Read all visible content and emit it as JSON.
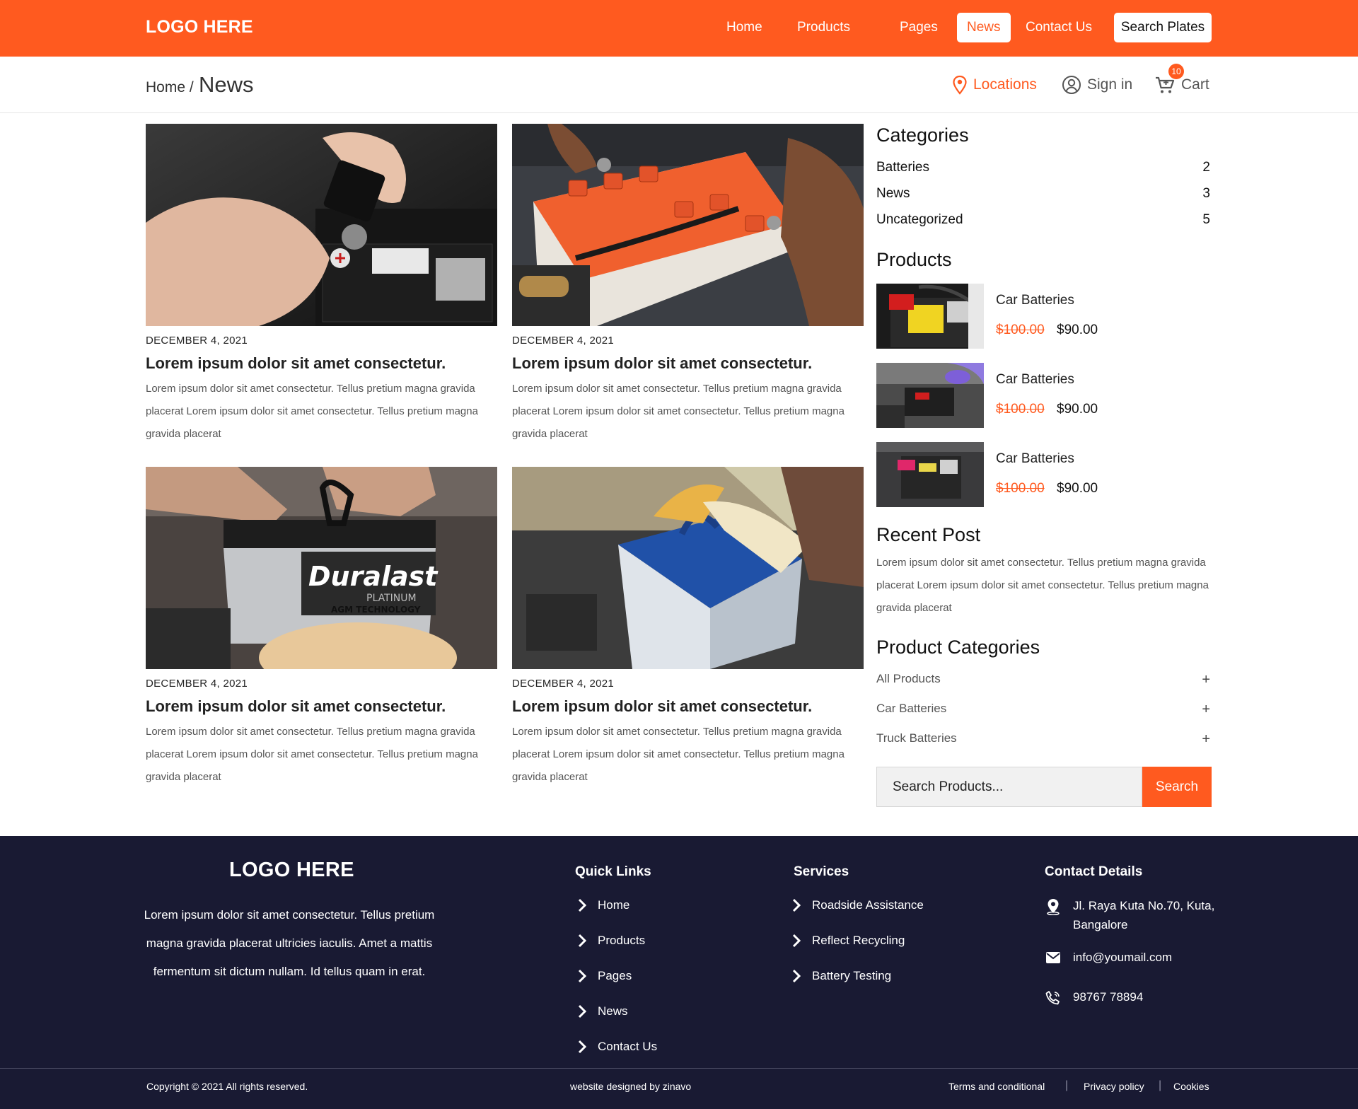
{
  "header": {
    "logo": "LOGO HERE",
    "nav": [
      "Home",
      "Products",
      "Pages",
      "News",
      "Contact Us"
    ],
    "active_nav": "News",
    "search_plates": "Search Plates",
    "brand_color": "#ff5a1f"
  },
  "subheader": {
    "breadcrumb_home": "Home /",
    "breadcrumb_current": "News",
    "locations": "Locations",
    "sign_in": "Sign in",
    "cart": "Cart",
    "cart_count": "10"
  },
  "posts": [
    {
      "date": "DECEMBER 4, 2021",
      "title": "Lorem ipsum dolor sit amet consectetur.",
      "excerpt": "Lorem ipsum dolor sit amet consectetur. Tellus pretium magna gravida placerat Lorem ipsum dolor sit amet consectetur. Tellus pretium magna gravida placerat"
    },
    {
      "date": "DECEMBER 4, 2021",
      "title": "Lorem ipsum dolor sit amet consectetur.",
      "excerpt": "Lorem ipsum dolor sit amet consectetur. Tellus pretium magna gravida placerat Lorem ipsum dolor sit amet consectetur. Tellus pretium magna gravida placerat"
    },
    {
      "date": "DECEMBER 4, 2021",
      "title": "Lorem ipsum dolor sit amet consectetur.",
      "excerpt": "Lorem ipsum dolor sit amet consectetur. Tellus pretium magna gravida placerat Lorem ipsum dolor sit amet consectetur. Tellus pretium magna gravida placerat"
    },
    {
      "date": "DECEMBER 4, 2021",
      "title": "Lorem ipsum dolor sit amet consectetur.",
      "excerpt": "Lorem ipsum dolor sit amet consectetur. Tellus pretium magna gravida placerat Lorem ipsum dolor sit amet consectetur. Tellus pretium magna gravida placerat"
    }
  ],
  "post_image_brand": "Duralast",
  "post_image_subtitle": "PLATINUM",
  "post_image_tagline": "AGM TECHNOLOGY",
  "sidebar": {
    "categories_title": "Categories",
    "categories": [
      {
        "name": "Batteries",
        "count": "2"
      },
      {
        "name": "News",
        "count": "3"
      },
      {
        "name": "Uncategorized",
        "count": "5"
      }
    ],
    "products_title": "Products",
    "products": [
      {
        "name": "Car Batteries",
        "old_price": "$100.00",
        "price": "$90.00"
      },
      {
        "name": "Car Batteries",
        "old_price": "$100.00",
        "price": "$90.00"
      },
      {
        "name": "Car Batteries",
        "old_price": "$100.00",
        "price": "$90.00"
      }
    ],
    "recent_title": "Recent Post",
    "recent_text": "Lorem ipsum dolor sit amet consectetur. Tellus pretium magna gravida placerat Lorem ipsum dolor sit amet consectetur. Tellus pretium magna gravida placerat",
    "product_categories_title": "Product Categories",
    "product_categories": [
      "All Products",
      "Car Batteries",
      "Truck Batteries"
    ],
    "expand_symbol": "+",
    "search_value": "Search Products...",
    "search_button": "Search"
  },
  "footer": {
    "logo": "LOGO HERE",
    "about": "Lorem ipsum dolor sit amet consectetur. Tellus pretium magna gravida placerat ultricies iaculis. Amet a mattis fermentum sit dictum nullam. Id tellus quam in erat.",
    "quick_links_title": "Quick Links",
    "quick_links": [
      "Home",
      "Products",
      "Pages",
      "News",
      "Contact Us"
    ],
    "services_title": "Services",
    "services": [
      "Roadside Assistance",
      "Reflect Recycling",
      "Battery Testing"
    ],
    "contact_title": "Contact Details",
    "address_line1": "Jl. Raya Kuta No.70, Kuta,",
    "address_line2": "Bangalore",
    "email": "info@youmail.com",
    "phone": "98767 78894",
    "copyright": "Copyright © 2021 All rights reserved.",
    "designed_by": "website designed by zinavo",
    "legal_links": [
      "Terms and conditional",
      "Privacy policy",
      "Cookies"
    ],
    "separator": "|",
    "background_color": "#191a33"
  }
}
